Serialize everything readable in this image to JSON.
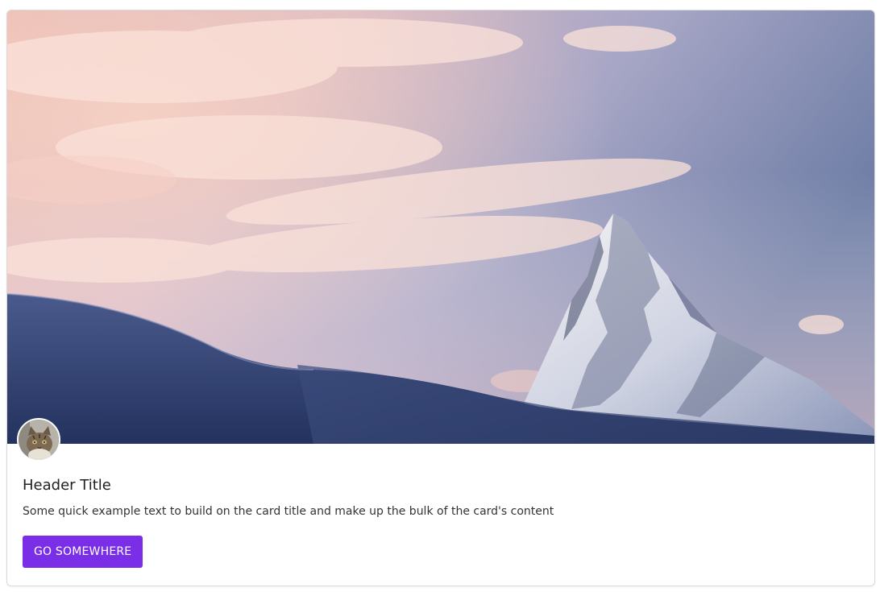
{
  "card": {
    "title": "Header Title",
    "text": "Some quick example text to build on the card title and make up the bulk of the card's content",
    "button_label": "GO SOMEWHERE"
  },
  "colors": {
    "button_bg": "#7b2ee8",
    "title": "#212121",
    "text": "#333333"
  },
  "hero": {
    "icon": "mountain-landscape-image"
  },
  "avatar": {
    "icon": "cat-avatar"
  }
}
